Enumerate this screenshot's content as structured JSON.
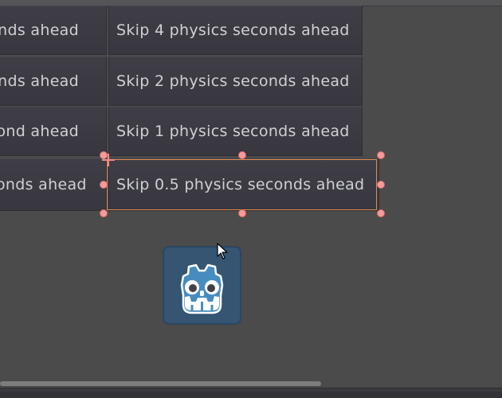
{
  "buttons": {
    "left_column": [
      "nds ahead",
      "nds ahead",
      "ond ahead",
      "onds ahead"
    ],
    "right_column": [
      "Skip 4 physics seconds ahead",
      "Skip 2 physics seconds ahead",
      "Skip 1 physics seconds ahead",
      "Skip 0.5 physics seconds ahead"
    ]
  },
  "selection": {
    "color": "#e08a4e",
    "handle_color": "#f79a9a"
  },
  "icons": {
    "godot_logo": "godot-logo-icon",
    "cursor": "mouse-pointer-icon"
  },
  "colors": {
    "viewport_bg": "#4b4b4b",
    "button_bg": "#3f3e47",
    "button_text": "#cfd0d6",
    "godot_blue": "#478cbf"
  }
}
